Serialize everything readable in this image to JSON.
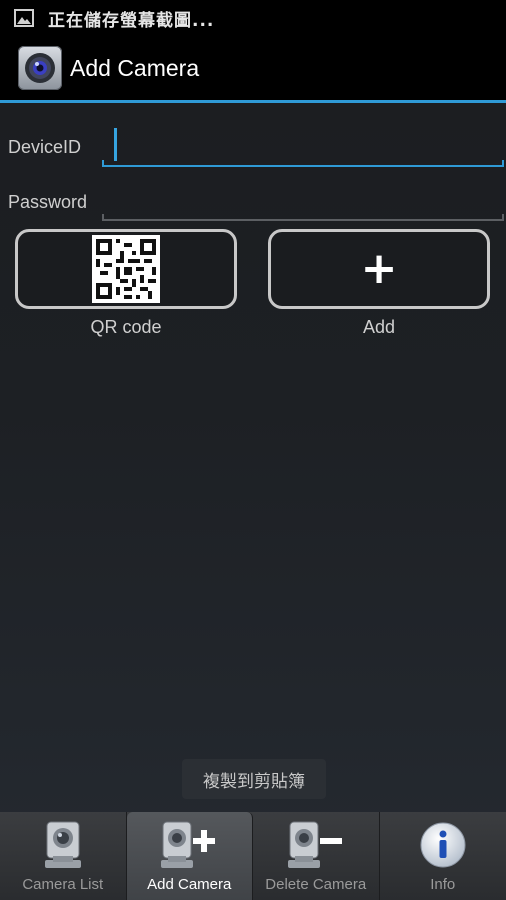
{
  "status_bar": {
    "text": "正在儲存螢幕截圖...",
    "icon": "image-icon"
  },
  "action_bar": {
    "title": "Add Camera",
    "icon": "camera-app-icon"
  },
  "form": {
    "device_id_label": "DeviceID",
    "device_id_value": "",
    "password_label": "Password",
    "password_value": ""
  },
  "buttons": {
    "qr_label": "QR code",
    "add_label": "Add",
    "add_glyph": "+"
  },
  "toast": {
    "text": "複製到剪貼簿"
  },
  "tabs": [
    {
      "label": "Camera List",
      "icon": "camera-icon",
      "active": false
    },
    {
      "label": "Add Camera",
      "icon": "add-camera-icon",
      "active": true
    },
    {
      "label": "Delete Camera",
      "icon": "delete-camera-icon",
      "active": false
    },
    {
      "label": "Info",
      "icon": "info-icon",
      "active": false
    }
  ],
  "colors": {
    "accent": "#2f9ad6",
    "background": "#1d2024"
  }
}
